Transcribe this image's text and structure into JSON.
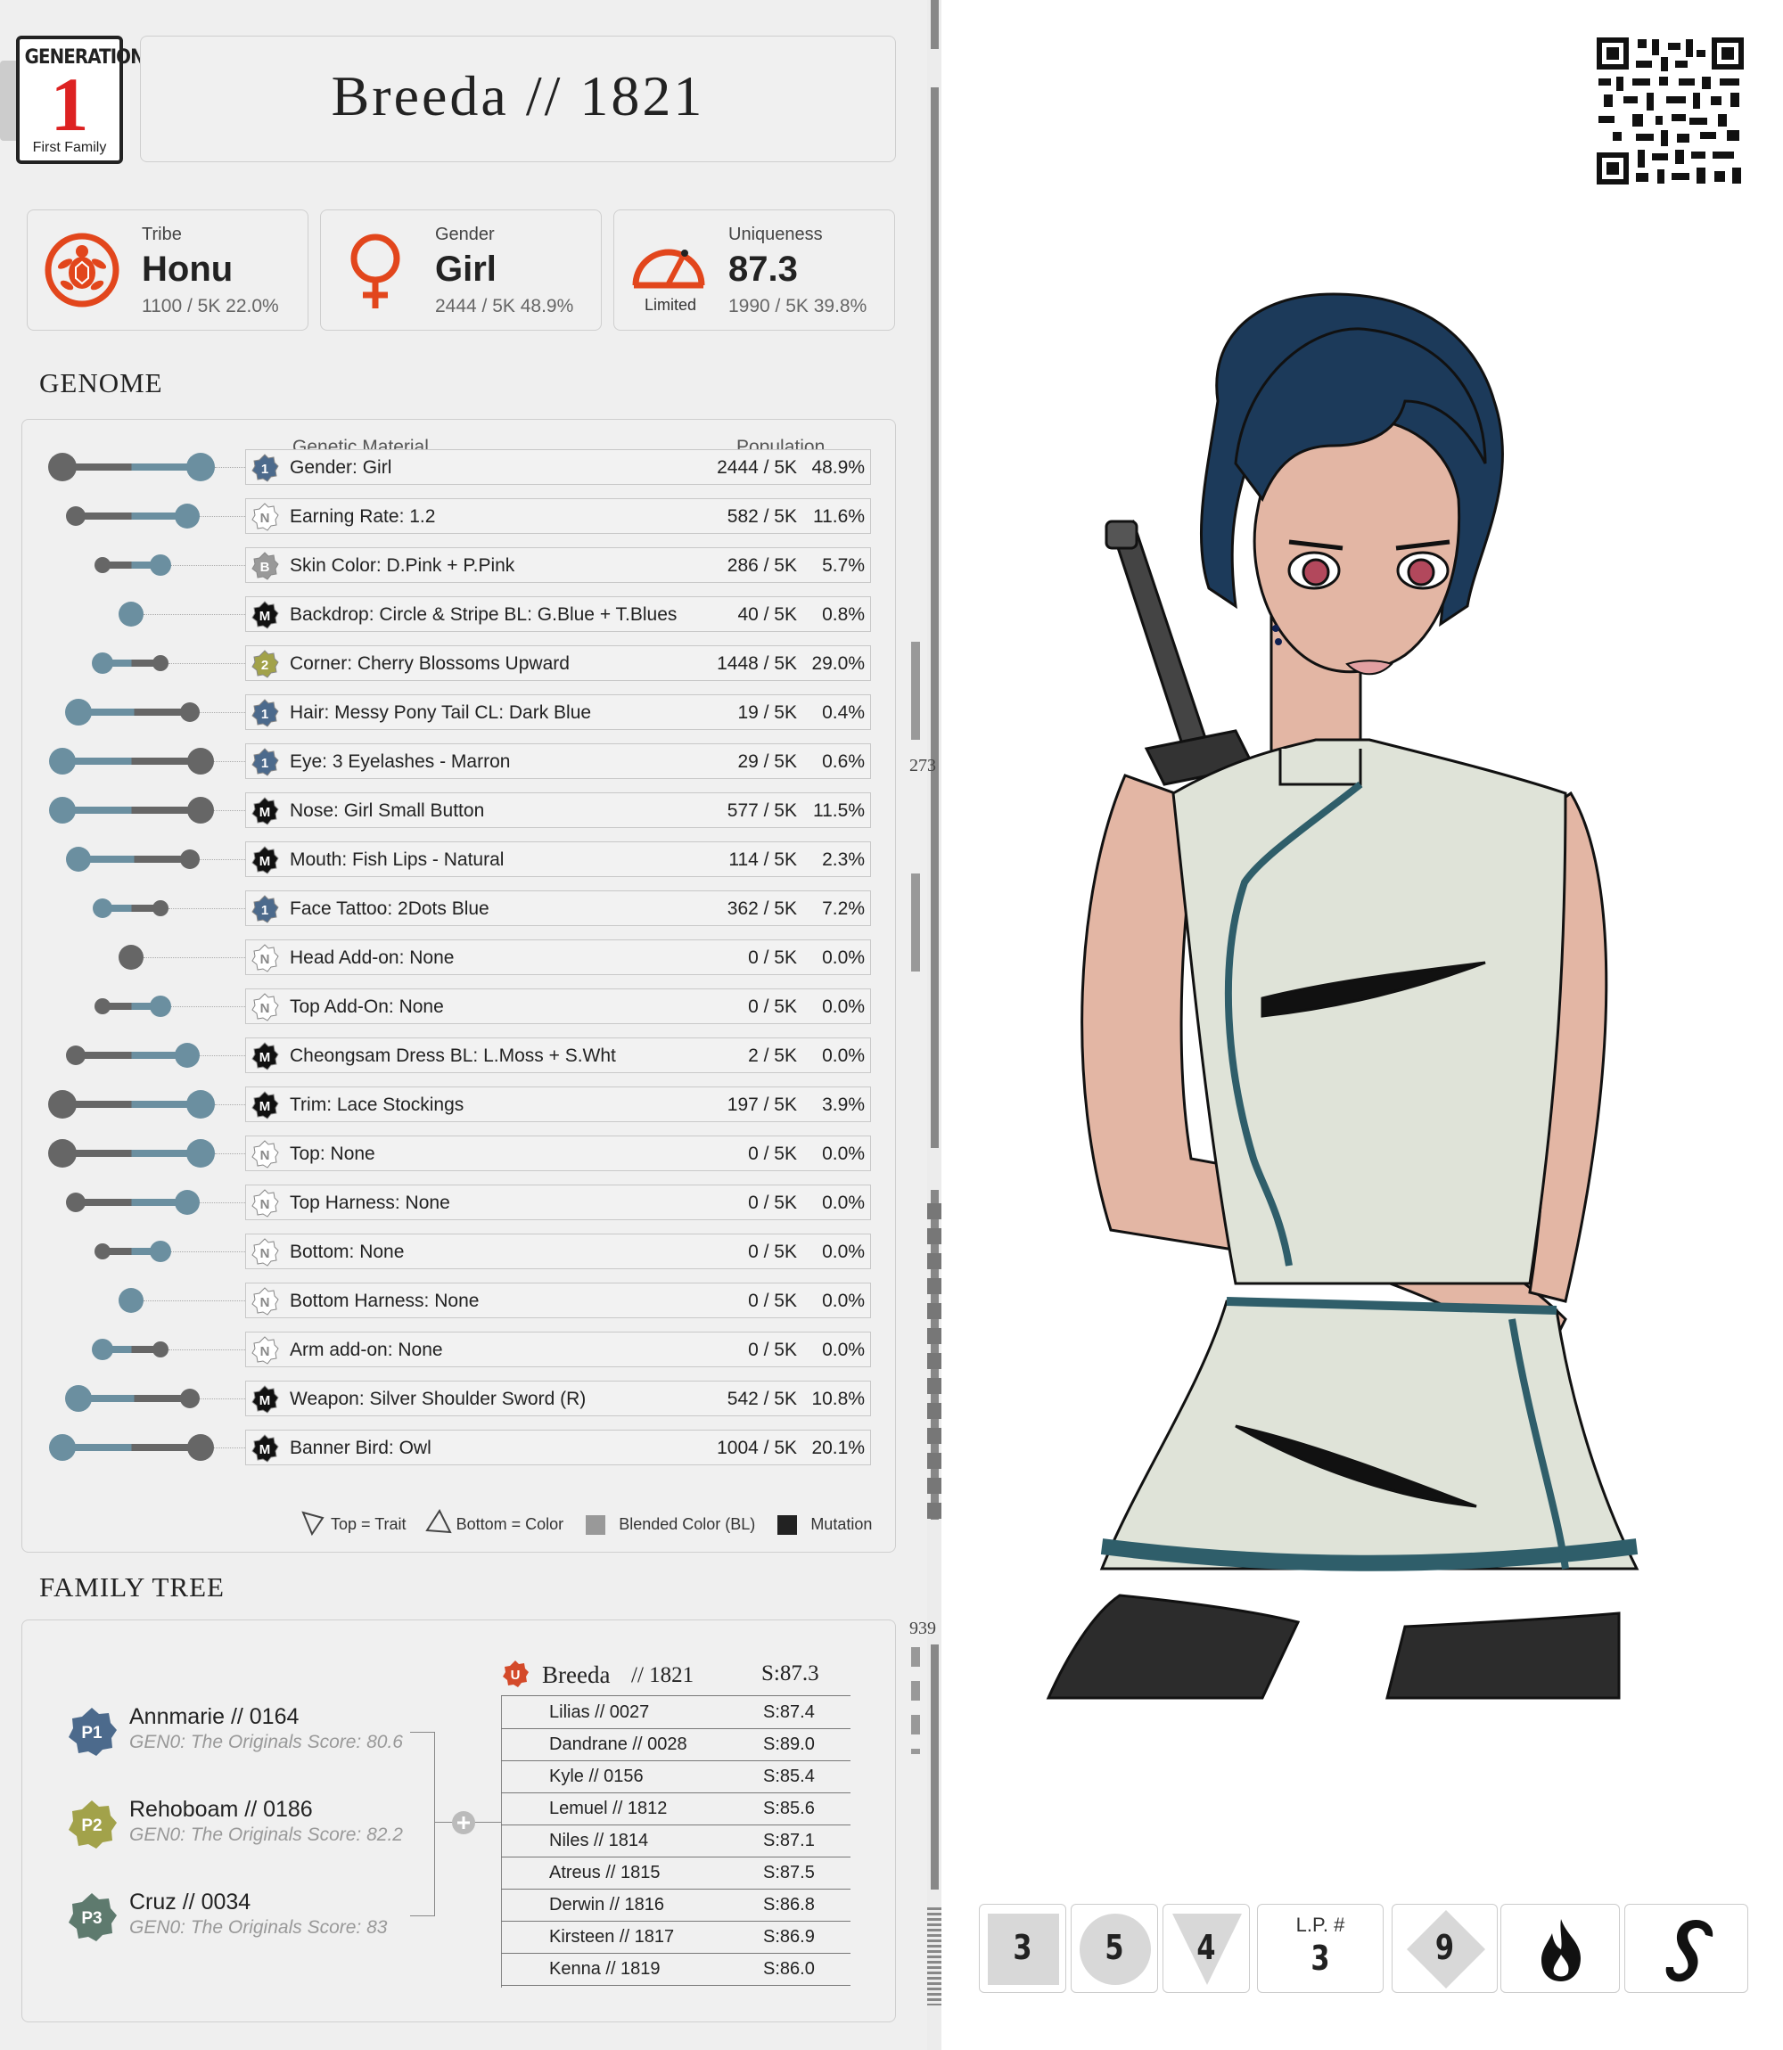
{
  "header": {
    "generation_label": "GENERATION",
    "generation_number": "1",
    "generation_caption": "First Family",
    "title": "Breeda // 1821"
  },
  "stats": [
    {
      "label": "Tribe",
      "value": "Honu",
      "sub": "1100 / 5K  22.0%",
      "icon": "turtle-icon"
    },
    {
      "label": "Gender",
      "value": "Girl",
      "sub": "2444 / 5K  48.9%",
      "icon": "female-symbol-icon"
    },
    {
      "label": "Uniqueness",
      "value": "87.3",
      "sub": "1990 / 5K  39.8%",
      "icon": "gauge-icon",
      "caption": "Limited"
    }
  ],
  "genome": {
    "section_title": "GENOME",
    "col_material": "Genetic Material",
    "col_population": "Population",
    "rows": [
      {
        "badge": "1",
        "text": "Gender: Girl",
        "count": "2444 / 5K",
        "pct": "48.9%"
      },
      {
        "badge": "N",
        "text": "Earning Rate: 1.2",
        "count": "582 / 5K",
        "pct": "11.6%"
      },
      {
        "badge": "B",
        "text": "Skin Color: D.Pink + P.Pink",
        "count": "286 / 5K",
        "pct": "5.7%"
      },
      {
        "badge": "M",
        "text": "Backdrop: Circle & Stripe BL: G.Blue + T.Blues",
        "count": "40 / 5K",
        "pct": "0.8%"
      },
      {
        "badge": "2",
        "text": "Corner: Cherry Blossoms Upward",
        "count": "1448 / 5K",
        "pct": "29.0%"
      },
      {
        "badge": "1",
        "text": "Hair: Messy Pony Tail CL: Dark Blue",
        "count": "19 / 5K",
        "pct": "0.4%"
      },
      {
        "badge": "1",
        "text": "Eye: 3 Eyelashes - Marron",
        "count": "29 / 5K",
        "pct": "0.6%"
      },
      {
        "badge": "M",
        "text": "Nose: Girl Small Button",
        "count": "577 / 5K",
        "pct": "11.5%"
      },
      {
        "badge": "M",
        "text": "Mouth: Fish Lips - Natural",
        "count": "114 / 5K",
        "pct": "2.3%"
      },
      {
        "badge": "1",
        "text": "Face Tattoo: 2Dots Blue",
        "count": "362 / 5K",
        "pct": "7.2%"
      },
      {
        "badge": "N",
        "text": "Head Add-on:  None",
        "count": "0 / 5K",
        "pct": "0.0%"
      },
      {
        "badge": "N",
        "text": "Top Add-On: None",
        "count": "0 / 5K",
        "pct": "0.0%"
      },
      {
        "badge": "M",
        "text": "Cheongsam Dress BL: L.Moss + S.Wht",
        "count": "2 / 5K",
        "pct": "0.0%"
      },
      {
        "badge": "M",
        "text": "Trim: Lace Stockings",
        "count": "197 / 5K",
        "pct": "3.9%"
      },
      {
        "badge": "N",
        "text": "Top: None",
        "count": "0 / 5K",
        "pct": "0.0%"
      },
      {
        "badge": "N",
        "text": "Top Harness: None",
        "count": "0 / 5K",
        "pct": "0.0%"
      },
      {
        "badge": "N",
        "text": "Bottom: None",
        "count": "0 / 5K",
        "pct": "0.0%"
      },
      {
        "badge": "N",
        "text": "Bottom Harness: None",
        "count": "0 / 5K",
        "pct": "0.0%"
      },
      {
        "badge": "N",
        "text": "Arm add-on: None",
        "count": "0 / 5K",
        "pct": "0.0%"
      },
      {
        "badge": "M",
        "text": "Weapon: Silver Shoulder Sword (R)",
        "count": "542 / 5K",
        "pct": "10.8%"
      },
      {
        "badge": "M",
        "text": "Banner Bird:  Owl",
        "count": "1004 / 5K",
        "pct": "20.1%"
      }
    ],
    "legend": {
      "top": "Top = Trait",
      "bottom": "Bottom = Color",
      "blended": "Blended Color (BL)",
      "mutation": "Mutation"
    }
  },
  "family_tree": {
    "section_title": "FAMILY TREE",
    "parents": [
      {
        "tag": "P1",
        "name": "Annmarie  //  0164",
        "score": "GEN0: The Originals Score: 80.6",
        "color": "#4c6a8c"
      },
      {
        "tag": "P2",
        "name": "Rehoboam  //  0186",
        "score": "GEN0: The Originals Score: 82.2",
        "color": "#a2a24a"
      },
      {
        "tag": "P3",
        "name": "Cruz  //  0034",
        "score": "GEN0: The Originals Score: 83",
        "color": "#5e7a6e"
      }
    ],
    "self": {
      "tag": "U",
      "name": "Breeda",
      "id": "// 1821",
      "score": "S:87.3"
    },
    "siblings": [
      {
        "name": "Lilias  //  0027",
        "score": "S:87.4"
      },
      {
        "name": "Dandrane  //  0028",
        "score": "S:89.0"
      },
      {
        "name": "Kyle  //  0156",
        "score": "S:85.4"
      },
      {
        "name": "Lemuel  //  1812",
        "score": "S:85.6"
      },
      {
        "name": "Niles  //  1814",
        "score": "S:87.1"
      },
      {
        "name": "Atreus  //  1815",
        "score": "S:87.5"
      },
      {
        "name": "Derwin  //  1816",
        "score": "S:86.8"
      },
      {
        "name": "Kirsteen  //  1817",
        "score": "S:86.9"
      },
      {
        "name": "Kenna  //  1819",
        "score": "S:86.0"
      }
    ]
  },
  "gutter": {
    "marker_a": "273",
    "marker_b": "939"
  },
  "tiles": [
    {
      "value": "3",
      "shape": "square"
    },
    {
      "value": "5",
      "shape": "circle"
    },
    {
      "value": "4",
      "shape": "triangle"
    },
    {
      "label": "L.P. #",
      "value": "3"
    },
    {
      "value": "9",
      "shape": "diamond"
    },
    {
      "icon": "flame-icon"
    },
    {
      "icon": "flamingo-icon"
    }
  ]
}
